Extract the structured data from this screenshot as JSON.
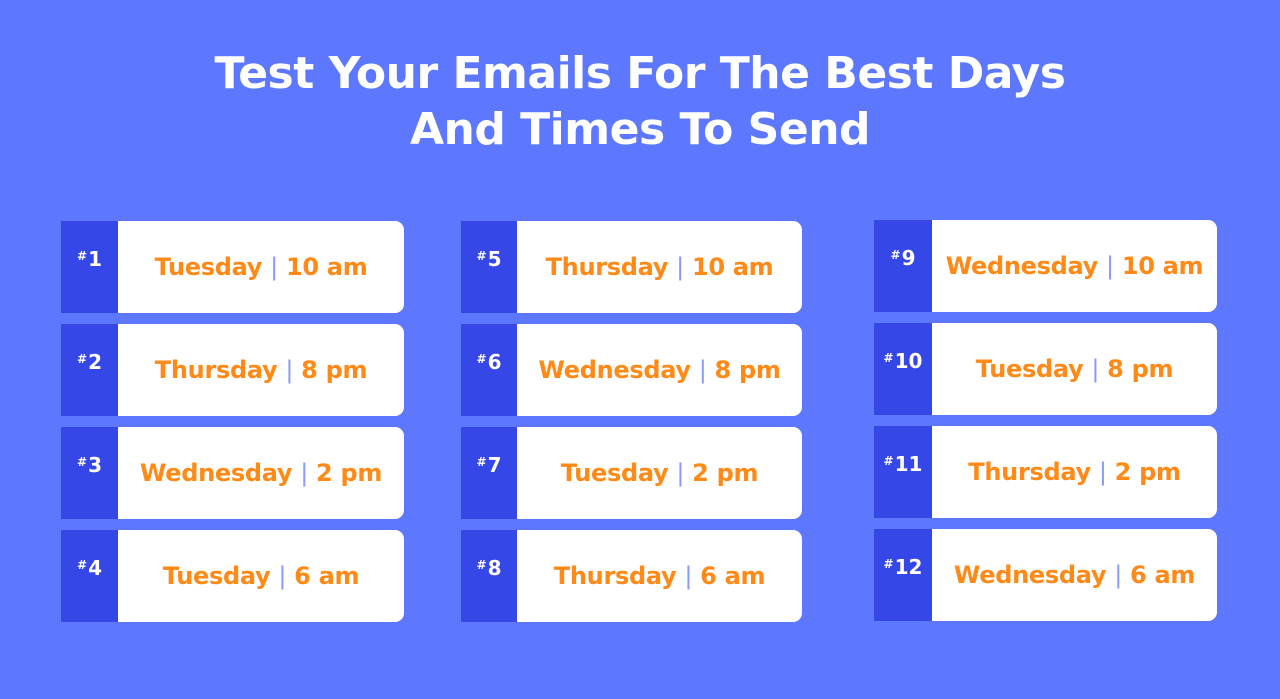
{
  "title": {
    "line1": "Test Your Emails For The Best Days",
    "line2": "And Times To Send"
  },
  "colors": {
    "background": "#5d78fe",
    "rank_tab": "#3547e6",
    "card": "#ffffff",
    "slot_text": "#ff8a17",
    "separator": "#8a9bf5"
  },
  "separator": "|",
  "hash": "#",
  "columns": [
    {
      "items": [
        {
          "rank": "1",
          "day": "Tuesday",
          "time": "10 am"
        },
        {
          "rank": "2",
          "day": "Thursday",
          "time": "8 pm"
        },
        {
          "rank": "3",
          "day": "Wednesday",
          "time": "2 pm"
        },
        {
          "rank": "4",
          "day": "Tuesday",
          "time": "6 am"
        }
      ]
    },
    {
      "items": [
        {
          "rank": "5",
          "day": "Thursday",
          "time": "10 am"
        },
        {
          "rank": "6",
          "day": "Wednesday",
          "time": "8 pm"
        },
        {
          "rank": "7",
          "day": "Tuesday",
          "time": "2 pm"
        },
        {
          "rank": "8",
          "day": "Thursday",
          "time": "6 am"
        }
      ]
    },
    {
      "items": [
        {
          "rank": "9",
          "day": "Wednesday",
          "time": "10 am"
        },
        {
          "rank": "10",
          "day": "Tuesday",
          "time": "8 pm"
        },
        {
          "rank": "11",
          "day": "Thursday",
          "time": "2 pm"
        },
        {
          "rank": "12",
          "day": "Wednesday",
          "time": "6 am"
        }
      ]
    }
  ]
}
